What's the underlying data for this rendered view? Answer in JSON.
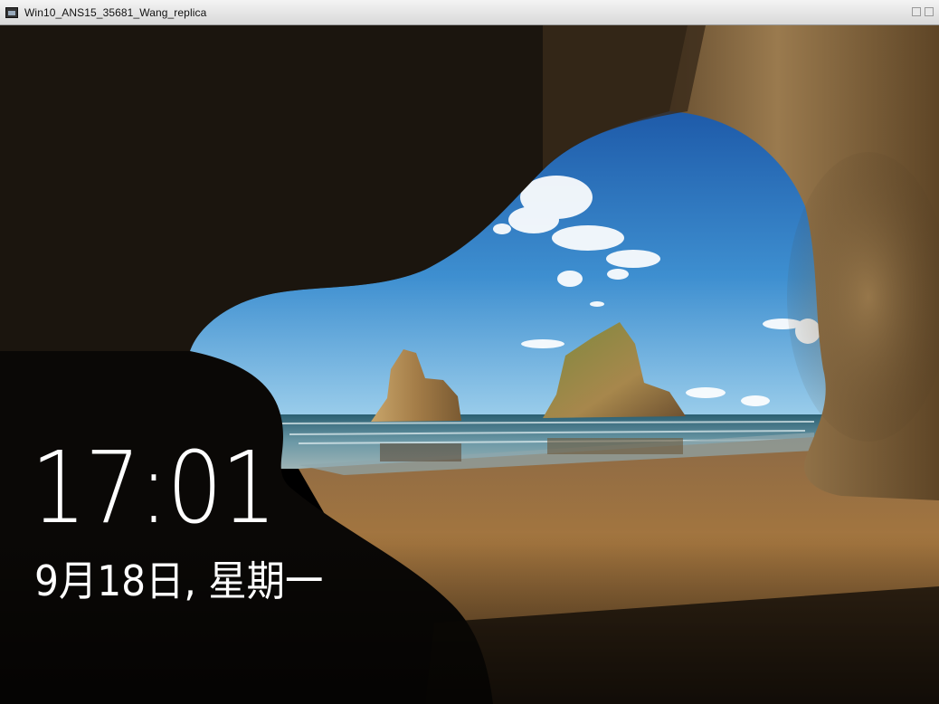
{
  "window": {
    "title": "Win10_ANS15_35681_Wang_replica"
  },
  "lockscreen": {
    "time": "17:01",
    "date": "9月18日, 星期一",
    "wallpaper": "sea-cave-beach-with-rock-stacks"
  },
  "colors": {
    "sky_top": "#1d5fae",
    "sky_horizon": "#8ec3e6",
    "sea": "#2f6b80",
    "sand": "#a07442",
    "cave_rock": "#2a2016",
    "text": "#ffffff"
  }
}
